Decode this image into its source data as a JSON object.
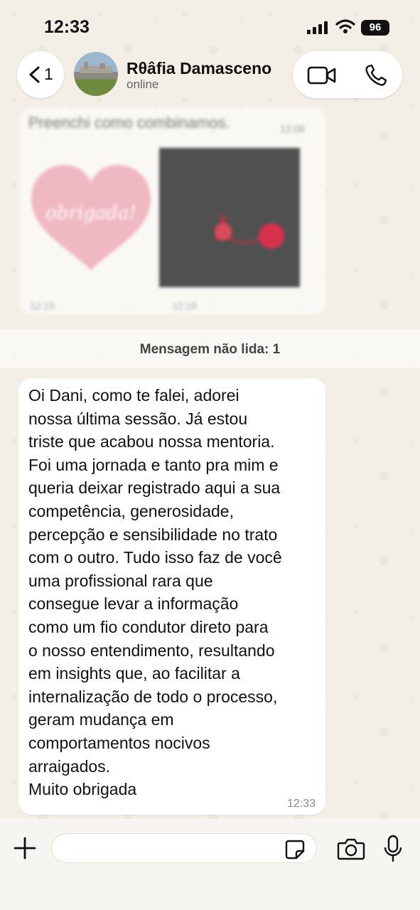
{
  "status_bar": {
    "time": "12:33",
    "battery": "96"
  },
  "header": {
    "back_count": "1",
    "contact_name": "Rθâfia Damasceno",
    "contact_status": "online"
  },
  "history": {
    "text_message": "Preenchi como combinamos.",
    "text_time": "12:06",
    "image_1_text": "obrigada!",
    "image_1_time": "12:15",
    "image_2_time": "12:18"
  },
  "unread_banner": "Mensagem não lida: 1",
  "message": {
    "text": "Oi Dani, como te falei, adorei\nnossa última sessão. Já estou\ntriste que acabou nossa mentoria.\nFoi uma jornada e tanto pra mim e\nqueria deixar registrado aqui a sua\ncompetência, generosidade,\npercepção e sensibilidade no trato\ncom o outro. Tudo isso faz de você\numa profissional rara que\nconsegue levar a informação\ncomo um fio condutor direto para\no nosso entendimento, resultando\nem  insights que, ao  facilitar a\ninternalização de todo o processo,\ngeram mudança em\ncomportamentos nocivos\narraigados.\nMuito obrigada",
    "time": "12:33"
  },
  "input": {
    "placeholder": ""
  },
  "icons": {
    "back": "chevron-left-icon",
    "video": "video-call-icon",
    "phone": "phone-icon",
    "plus": "plus-icon",
    "sticker": "sticker-icon",
    "camera": "camera-icon",
    "mic": "microphone-icon"
  },
  "colors": {
    "wallpaper": "#f3efe7",
    "bubble": "#ffffff",
    "heart": "#f0b8c2"
  }
}
